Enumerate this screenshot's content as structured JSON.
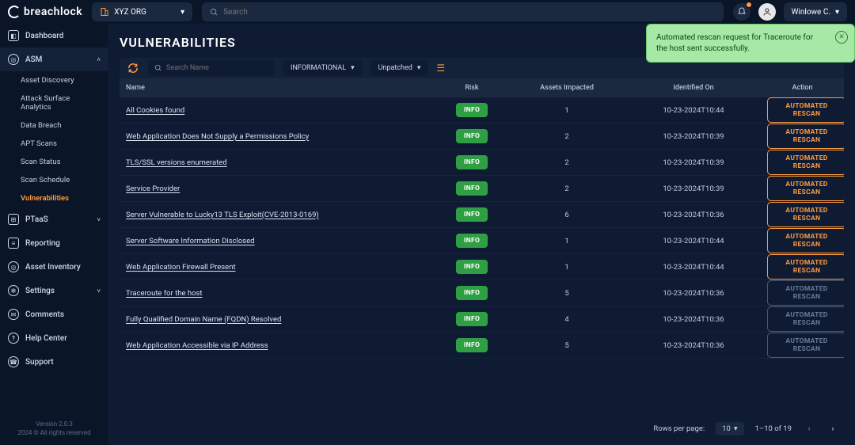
{
  "brand": "breachlock",
  "org": {
    "name": "XYZ ORG"
  },
  "search": {
    "placeholder": "Search"
  },
  "user": {
    "name": "Winlowe C."
  },
  "toast": {
    "message": "Automated rescan request for Traceroute for the host sent successfully."
  },
  "sidebar": {
    "dashboard": "Dashboard",
    "asm": "ASM",
    "asm_items": [
      "Asset Discovery",
      "Attack Surface Analytics",
      "Data Breach",
      "APT Scans",
      "Scan Status",
      "Scan Schedule",
      "Vulnerabilities"
    ],
    "ptaas": "PTaaS",
    "reporting": "Reporting",
    "asset_inventory": "Asset Inventory",
    "settings": "Settings",
    "comments": "Comments",
    "help": "Help Center",
    "support": "Support",
    "version": "Version 2.0.3",
    "copyright": "2024 © All rights reserved"
  },
  "page": {
    "title": "VULNERABILITIES",
    "search_placeholder": "Search Name",
    "severity_filter": "INFORMATIONAL",
    "status_filter": "Unpatched"
  },
  "table": {
    "headers": {
      "name": "Name",
      "risk": "Risk",
      "assets": "Assets Impacted",
      "date": "Identified On",
      "action": "Action"
    },
    "risk_label": "INFO",
    "action_label": "AUTOMATED RESCAN",
    "rows": [
      {
        "name": "All Cookies found",
        "assets": "1",
        "date": "10-23-2024T10:44",
        "disabled": false
      },
      {
        "name": "Web Application Does Not Supply a Permissions Policy",
        "assets": "2",
        "date": "10-23-2024T10:39",
        "disabled": false
      },
      {
        "name": "TLS/SSL versions enumerated",
        "assets": "2",
        "date": "10-23-2024T10:39",
        "disabled": false
      },
      {
        "name": "Service Provider",
        "assets": "2",
        "date": "10-23-2024T10:39",
        "disabled": false
      },
      {
        "name": "Server Vulnerable to Lucky13 TLS Exploit(CVE-2013-0169)",
        "assets": "6",
        "date": "10-23-2024T10:36",
        "disabled": false
      },
      {
        "name": "Server Software Information Disclosed",
        "assets": "1",
        "date": "10-23-2024T10:44",
        "disabled": false
      },
      {
        "name": "Web Application Firewall Present",
        "assets": "1",
        "date": "10-23-2024T10:44",
        "disabled": false
      },
      {
        "name": "Traceroute for the host",
        "assets": "5",
        "date": "10-23-2024T10:36",
        "disabled": true
      },
      {
        "name": "Fully Qualified Domain Name (FQDN) Resolved",
        "assets": "4",
        "date": "10-23-2024T10:36",
        "disabled": true
      },
      {
        "name": "Web Application Accessible via IP Address",
        "assets": "5",
        "date": "10-23-2024T10:36",
        "disabled": true
      }
    ]
  },
  "pager": {
    "rows_label": "Rows per page:",
    "size": "10",
    "range": "1–10 of 19"
  }
}
